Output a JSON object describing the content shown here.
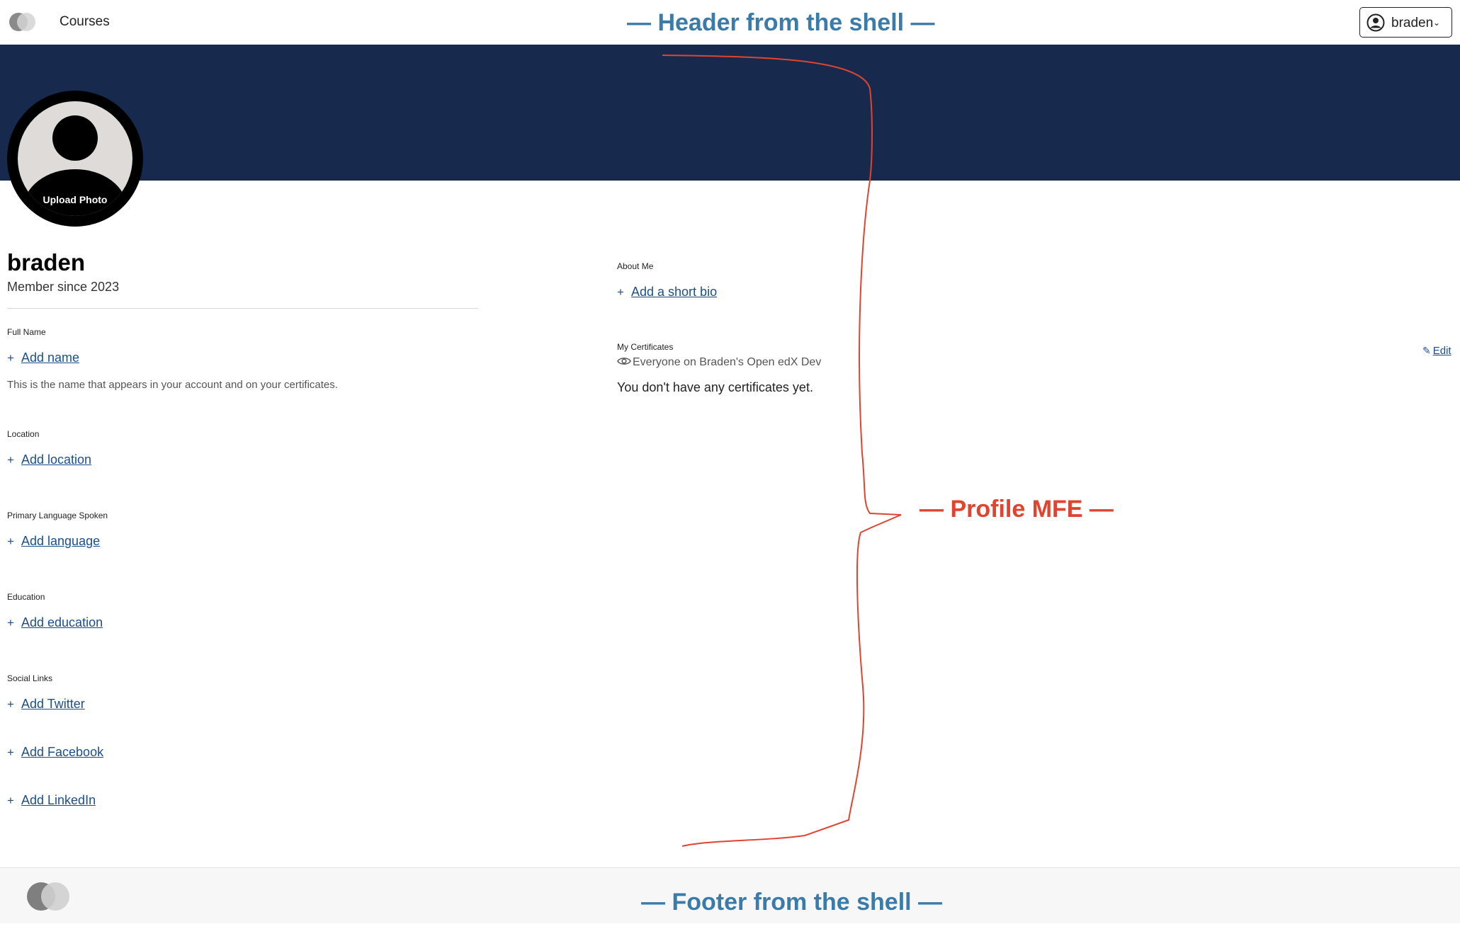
{
  "header": {
    "nav_courses": "Courses",
    "user_menu_label": "braden",
    "annotation": "— Header from the shell —"
  },
  "profile": {
    "upload_photo": "Upload Photo",
    "username": "braden",
    "member_since": "Member since 2023",
    "annotation": "— Profile MFE —"
  },
  "left_fields": {
    "full_name": {
      "label": "Full Name",
      "add": "Add name",
      "helper": "This is the name that appears in your account and on your certificates."
    },
    "location": {
      "label": "Location",
      "add": "Add location"
    },
    "language": {
      "label": "Primary Language Spoken",
      "add": "Add language"
    },
    "education": {
      "label": "Education",
      "add": "Add education"
    },
    "social": {
      "label": "Social Links",
      "twitter": "Add Twitter",
      "facebook": "Add Facebook",
      "linkedin": "Add LinkedIn"
    }
  },
  "right_fields": {
    "about": {
      "label": "About Me",
      "add": "Add a short bio"
    },
    "certificates": {
      "label": "My Certificates",
      "visibility": "Everyone on Braden's Open edX Dev",
      "empty": "You don't have any certificates yet.",
      "edit": "Edit"
    }
  },
  "footer": {
    "annotation": "— Footer from the shell —"
  },
  "colors": {
    "banner": "#172a4d",
    "link": "#1c4f8a",
    "annotation_blue": "#3a7ba9",
    "annotation_red": "#e0442e"
  },
  "icons": [
    "logo-icon",
    "user-circle-icon",
    "chevron-down-icon",
    "plus-icon",
    "eye-icon",
    "pencil-icon"
  ]
}
